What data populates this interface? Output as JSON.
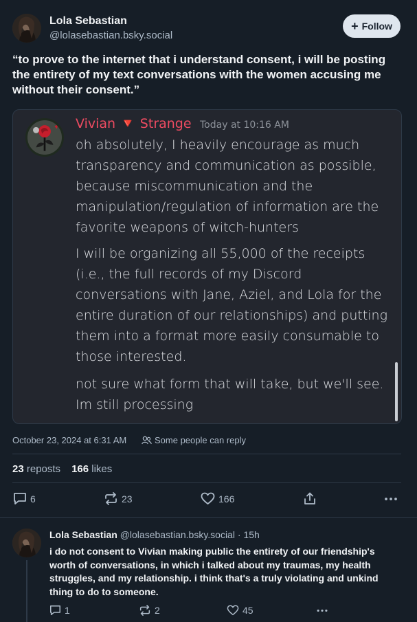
{
  "post": {
    "author": {
      "name": "Lola Sebastian",
      "handle": "@lolasebastian.bsky.social"
    },
    "follow_label": "Follow",
    "text": "“to prove to the internet that i understand consent, i will be posting the entirety of my text conversations with the women accusing me without their consent.”",
    "embed": {
      "author_name": "Vivian 🔻 Strange",
      "timestamp": "Today at 10:16 AM",
      "messages": [
        "oh absolutely, I heavily encourage as much transparency and communication as possible, because miscommunication and the manipulation/regulation of information are the favorite weapons of witch-hunters",
        "I will be organizing all 55,000 of the receipts (i.e., the full records of my Discord conversations with Jane, Aziel, and Lola for the entire duration of our relationships) and putting them into a format more easily consumable to those interested.",
        "not sure what form that will take, but we'll see. Im still processing"
      ]
    },
    "date": "October 23, 2024 at 6:31 AM",
    "reply_setting": "Some people can reply",
    "reposts_count": "23",
    "reposts_label": "reposts",
    "likes_count": "166",
    "likes_label": "likes",
    "actions": {
      "replies": "6",
      "reposts": "23",
      "likes": "166"
    }
  },
  "reply": {
    "author": {
      "name": "Lola Sebastian",
      "handle": "@lolasebastian.bsky.social",
      "time": "· 15h"
    },
    "text": "i do not consent to Vivian making public the entirety of our friendship's worth of conversations, in which i talked about my traumas, my health struggles, and my relationship. i think that's a truly violating and unkind thing to do to someone.",
    "actions": {
      "replies": "1",
      "reposts": "2",
      "likes": "45"
    }
  },
  "colors": {
    "background": "#161e27",
    "embed_background": "#23262e",
    "discord_name": "#ee4b61",
    "muted": "#aebbc9"
  },
  "icons": [
    "plus-icon",
    "people-icon",
    "reply-icon",
    "repost-icon",
    "heart-icon",
    "share-icon",
    "more-icon",
    "rose-avatar"
  ]
}
